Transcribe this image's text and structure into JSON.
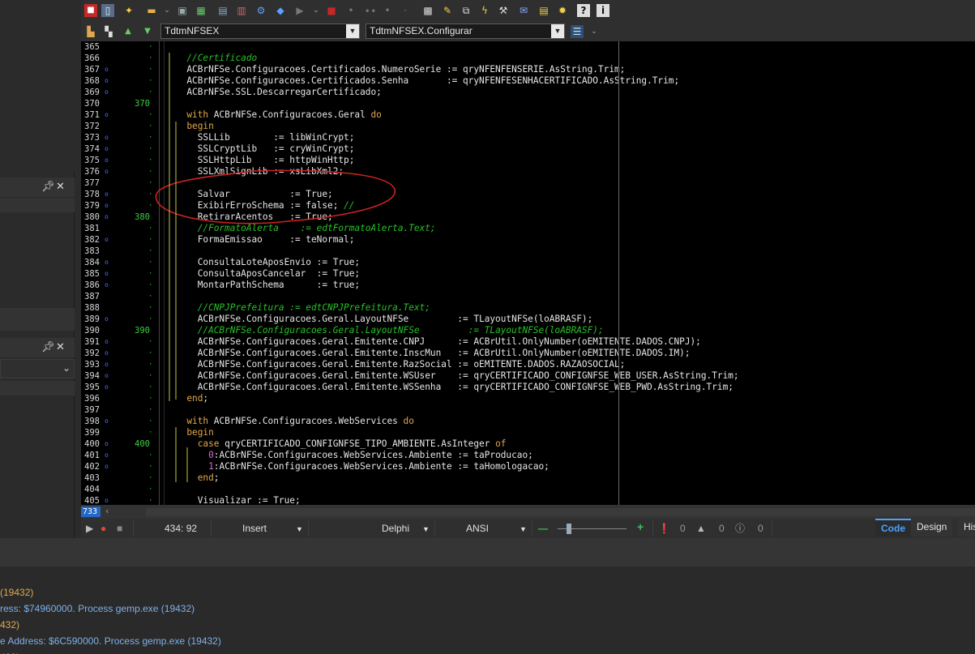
{
  "toolbar": {
    "unit_combo": "TdtmNFSEX",
    "method_combo": "TdtmNFSEX.Configurar"
  },
  "gutter": {
    "markers": [
      {
        "row": 5,
        "label": "370"
      },
      {
        "row": 15,
        "label": "380"
      },
      {
        "row": 25,
        "label": "390"
      },
      {
        "row": 35,
        "label": "400"
      }
    ]
  },
  "code_lines": [
    {
      "n": "365",
      "bp": false,
      "segs": [
        {
          "t": "",
          "c": ""
        }
      ]
    },
    {
      "n": "366",
      "bp": false,
      "segs": [
        {
          "t": "  ",
          "c": ""
        },
        {
          "t": "//Certificado",
          "c": "cm"
        }
      ]
    },
    {
      "n": "367",
      "bp": true,
      "segs": [
        {
          "t": "  ACBrNFSe.Configuracoes.Certificados.NumeroSerie := qryNFENFENSERIE.AsString.Trim;",
          "c": ""
        }
      ]
    },
    {
      "n": "368",
      "bp": true,
      "segs": [
        {
          "t": "  ACBrNFSe.Configuracoes.Certificados.Senha       := qryNFENFESENHACERTIFICADO.AsString.Trim;",
          "c": ""
        }
      ]
    },
    {
      "n": "369",
      "bp": true,
      "segs": [
        {
          "t": "  ACBrNFSe.SSL.DescarregarCertificado;",
          "c": ""
        }
      ]
    },
    {
      "n": "370",
      "bp": false,
      "segs": [
        {
          "t": "",
          "c": ""
        }
      ]
    },
    {
      "n": "371",
      "bp": true,
      "segs": [
        {
          "t": "  ",
          "c": ""
        },
        {
          "t": "with",
          "c": "kw"
        },
        {
          "t": " ACBrNFSe.Configuracoes.Geral ",
          "c": ""
        },
        {
          "t": "do",
          "c": "kw"
        }
      ]
    },
    {
      "n": "372",
      "bp": false,
      "segs": [
        {
          "t": "  ",
          "c": ""
        },
        {
          "t": "begin",
          "c": "kw"
        }
      ]
    },
    {
      "n": "373",
      "bp": true,
      "segs": [
        {
          "t": "    SSLLib        := libWinCrypt;",
          "c": ""
        }
      ]
    },
    {
      "n": "374",
      "bp": true,
      "segs": [
        {
          "t": "    SSLCryptLib   := cryWinCrypt;",
          "c": ""
        }
      ]
    },
    {
      "n": "375",
      "bp": true,
      "segs": [
        {
          "t": "    SSLHttpLib    := httpWinHttp;",
          "c": ""
        }
      ]
    },
    {
      "n": "376",
      "bp": true,
      "segs": [
        {
          "t": "    SSLXmlSignLib := xsLibXml2;",
          "c": ""
        }
      ]
    },
    {
      "n": "377",
      "bp": false,
      "segs": [
        {
          "t": "",
          "c": ""
        }
      ]
    },
    {
      "n": "378",
      "bp": true,
      "segs": [
        {
          "t": "    Salvar           := True;",
          "c": ""
        }
      ]
    },
    {
      "n": "379",
      "bp": true,
      "segs": [
        {
          "t": "    ExibirErroSchema := false; ",
          "c": ""
        },
        {
          "t": "//",
          "c": "cm"
        }
      ]
    },
    {
      "n": "380",
      "bp": true,
      "segs": [
        {
          "t": "    RetirarAcentos   := True;",
          "c": ""
        }
      ]
    },
    {
      "n": "381",
      "bp": false,
      "segs": [
        {
          "t": "    ",
          "c": ""
        },
        {
          "t": "//FormatoAlerta    := edtFormatoAlerta.Text;",
          "c": "cm"
        }
      ]
    },
    {
      "n": "382",
      "bp": true,
      "segs": [
        {
          "t": "    FormaEmissao     := teNormal;",
          "c": ""
        }
      ]
    },
    {
      "n": "383",
      "bp": false,
      "segs": [
        {
          "t": "",
          "c": ""
        }
      ]
    },
    {
      "n": "384",
      "bp": true,
      "segs": [
        {
          "t": "    ConsultaLoteAposEnvio := True;",
          "c": ""
        }
      ]
    },
    {
      "n": "385",
      "bp": true,
      "segs": [
        {
          "t": "    ConsultaAposCancelar  := True;",
          "c": ""
        }
      ]
    },
    {
      "n": "386",
      "bp": true,
      "segs": [
        {
          "t": "    MontarPathSchema      := true;",
          "c": ""
        }
      ]
    },
    {
      "n": "387",
      "bp": false,
      "segs": [
        {
          "t": "",
          "c": ""
        }
      ]
    },
    {
      "n": "388",
      "bp": false,
      "segs": [
        {
          "t": "    ",
          "c": ""
        },
        {
          "t": "//CNPJPrefeitura := edtCNPJPrefeitura.Text;",
          "c": "cm"
        }
      ]
    },
    {
      "n": "389",
      "bp": true,
      "segs": [
        {
          "t": "    ACBrNFSe.Configuracoes.Geral.LayoutNFSe         := TLayoutNFSe(loABRASF);",
          "c": ""
        }
      ]
    },
    {
      "n": "390",
      "bp": false,
      "segs": [
        {
          "t": "    ",
          "c": ""
        },
        {
          "t": "//ACBrNFSe.Configuracoes.Geral.LayoutNFSe         := TLayoutNFSe(loABRASF);",
          "c": "cm"
        }
      ]
    },
    {
      "n": "391",
      "bp": true,
      "segs": [
        {
          "t": "    ACBrNFSe.Configuracoes.Geral.Emitente.CNPJ      := ACBrUtil.OnlyNumber(oEMITENTE.DADOS.CNPJ);",
          "c": ""
        }
      ]
    },
    {
      "n": "392",
      "bp": true,
      "segs": [
        {
          "t": "    ACBrNFSe.Configuracoes.Geral.Emitente.InscMun   := ACBrUtil.OnlyNumber(oEMITENTE.DADOS.IM);",
          "c": ""
        }
      ]
    },
    {
      "n": "393",
      "bp": true,
      "segs": [
        {
          "t": "    ACBrNFSe.Configuracoes.Geral.Emitente.RazSocial := oEMITENTE.DADOS.RAZAOSOCIAL;",
          "c": ""
        }
      ]
    },
    {
      "n": "394",
      "bp": true,
      "segs": [
        {
          "t": "    ACBrNFSe.Configuracoes.Geral.Emitente.WSUser    := qryCERTIFICADO_CONFIGNFSE_WEB_USER.AsString.Trim;",
          "c": ""
        }
      ]
    },
    {
      "n": "395",
      "bp": true,
      "segs": [
        {
          "t": "    ACBrNFSe.Configuracoes.Geral.Emitente.WSSenha   := qryCERTIFICADO_CONFIGNFSE_WEB_PWD.AsString.Trim;",
          "c": ""
        }
      ]
    },
    {
      "n": "396",
      "bp": false,
      "segs": [
        {
          "t": "  ",
          "c": ""
        },
        {
          "t": "end",
          "c": "kw"
        },
        {
          "t": ";",
          "c": ""
        }
      ]
    },
    {
      "n": "397",
      "bp": false,
      "segs": [
        {
          "t": "",
          "c": ""
        }
      ]
    },
    {
      "n": "398",
      "bp": true,
      "segs": [
        {
          "t": "  ",
          "c": ""
        },
        {
          "t": "with",
          "c": "kw"
        },
        {
          "t": " ACBrNFSe.Configuracoes.WebServices ",
          "c": ""
        },
        {
          "t": "do",
          "c": "kw"
        }
      ]
    },
    {
      "n": "399",
      "bp": false,
      "segs": [
        {
          "t": "  ",
          "c": ""
        },
        {
          "t": "begin",
          "c": "kw"
        }
      ]
    },
    {
      "n": "400",
      "bp": true,
      "segs": [
        {
          "t": "    ",
          "c": ""
        },
        {
          "t": "case",
          "c": "kw"
        },
        {
          "t": " qryCERTIFICADO_CONFIGNFSE_TIPO_AMBIENTE.AsInteger ",
          "c": ""
        },
        {
          "t": "of",
          "c": "kw"
        }
      ]
    },
    {
      "n": "401",
      "bp": true,
      "segs": [
        {
          "t": "      ",
          "c": ""
        },
        {
          "t": "0",
          "c": "nm"
        },
        {
          "t": ":ACBrNFSe.Configuracoes.WebServices.Ambiente := taProducao;",
          "c": ""
        }
      ]
    },
    {
      "n": "402",
      "bp": true,
      "segs": [
        {
          "t": "      ",
          "c": ""
        },
        {
          "t": "1",
          "c": "nm"
        },
        {
          "t": ":ACBrNFSe.Configuracoes.WebServices.Ambiente := taHomologacao;",
          "c": ""
        }
      ]
    },
    {
      "n": "403",
      "bp": false,
      "segs": [
        {
          "t": "    ",
          "c": ""
        },
        {
          "t": "end",
          "c": "kw"
        },
        {
          "t": ";",
          "c": ""
        }
      ]
    },
    {
      "n": "404",
      "bp": false,
      "segs": [
        {
          "t": "",
          "c": ""
        }
      ]
    },
    {
      "n": "405",
      "bp": true,
      "segs": [
        {
          "t": "    Visualizar := True;",
          "c": ""
        }
      ]
    }
  ],
  "hscroll": {
    "line_count": "733"
  },
  "statusbar": {
    "position": "434:  92",
    "mode": "Insert",
    "language": "Delphi",
    "encoding": "ANSI",
    "errors": "0",
    "warnings": "0",
    "hints": "0",
    "zoom_level": 0.13
  },
  "view_tabs": [
    {
      "label": "Code",
      "active": true
    },
    {
      "label": "Design",
      "active": false
    },
    {
      "label": "His",
      "active": false
    }
  ],
  "messages": [
    {
      "text": "(19432)",
      "color": "#e0a850"
    },
    {
      "text": "ress: $74960000. Process gemp.exe (19432)",
      "color": "#7fb0e8"
    },
    {
      "text": "432)",
      "color": "#e0a850"
    },
    {
      "text": "e Address: $6C590000. Process gemp.exe (19432)",
      "color": "#7fb0e8"
    },
    {
      "text": "432)",
      "color": "#e0a850"
    }
  ],
  "colors": {
    "accent": "#4aa3ff",
    "editor_bg": "#000000",
    "annotation": "#cc2222"
  }
}
